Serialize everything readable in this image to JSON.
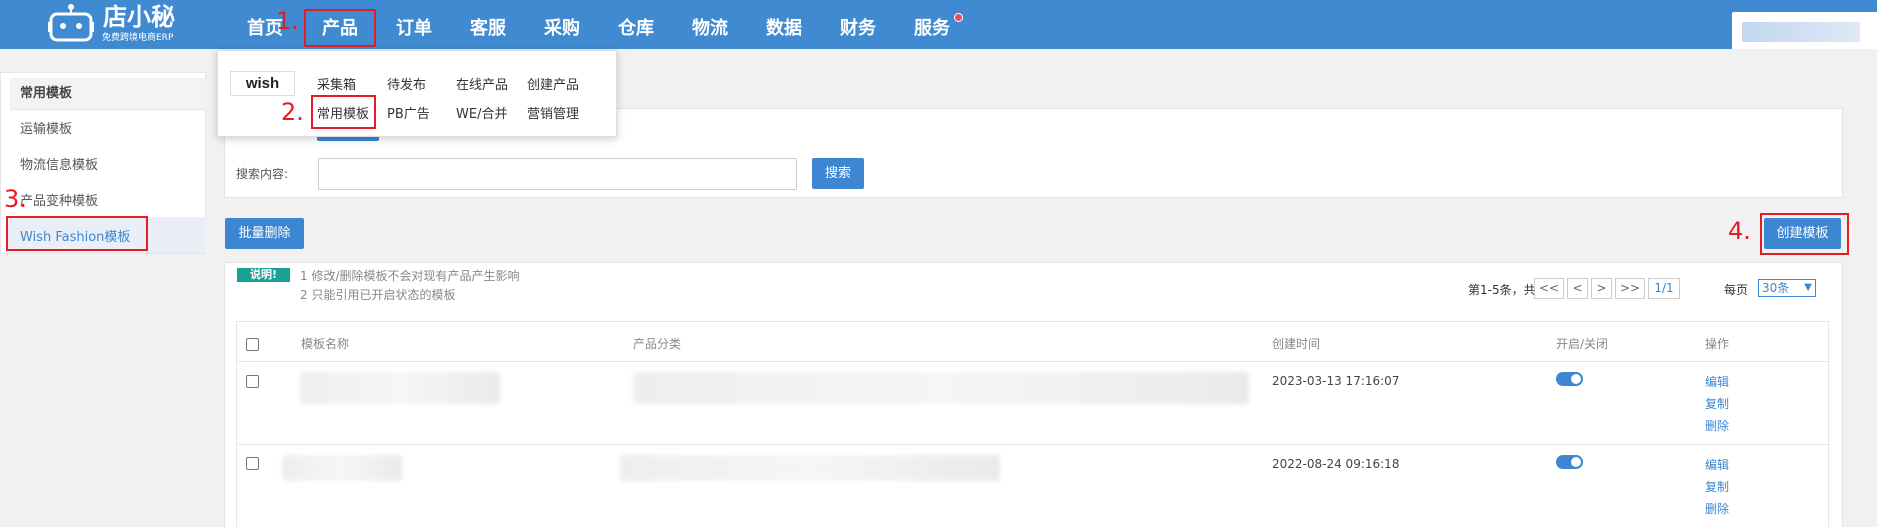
{
  "topbar": {
    "logo_text": "店小秘",
    "logo_sub": "免费跨境电商ERP",
    "nav": [
      "首页",
      "产品",
      "订单",
      "客服",
      "采购",
      "仓库",
      "物流",
      "数据",
      "财务",
      "服务"
    ]
  },
  "steps": [
    "1.",
    "2.",
    "3.",
    "4."
  ],
  "dropdown": {
    "brand": "wish",
    "row1": [
      "采集箱",
      "待发布",
      "在线产品",
      "创建产品"
    ],
    "row2": [
      "常用模板",
      "PB广告",
      "WE/合并",
      "营销管理"
    ]
  },
  "sidebar": {
    "title": "常用模板",
    "items": [
      "运输模板",
      "物流信息模板",
      "产品变种模板",
      "Wish Fashion模板"
    ]
  },
  "search": {
    "label": "搜索内容:",
    "value": "",
    "button": "搜索"
  },
  "toolbar": {
    "batch_delete": "批量删除",
    "create": "创建模板"
  },
  "notice": {
    "tag": "说明!",
    "lines": [
      "1 修改/删除模板不会对现有产品产生影响",
      "2 只能引用已开启状态的模板"
    ]
  },
  "pagination": {
    "summary": "第1-5条，共5条",
    "buttons": [
      "<<",
      "<",
      ">",
      ">>"
    ],
    "page": "1/1",
    "per_page_label": "每页",
    "per_page": "30条"
  },
  "table": {
    "headers": [
      "模板名称",
      "产品分类",
      "创建时间",
      "开启/关闭",
      "操作"
    ],
    "rows": [
      {
        "created": "2023-03-13 17:16:07",
        "enabled": true,
        "ops": [
          "编辑",
          "复制",
          "删除"
        ]
      },
      {
        "created": "2022-08-24 09:16:18",
        "enabled": true,
        "ops": [
          "编辑",
          "复制",
          "删除"
        ]
      }
    ]
  },
  "colors": {
    "primary": "#3f8ad0",
    "annotation": "#e51c23",
    "notice": "#1aa094"
  }
}
